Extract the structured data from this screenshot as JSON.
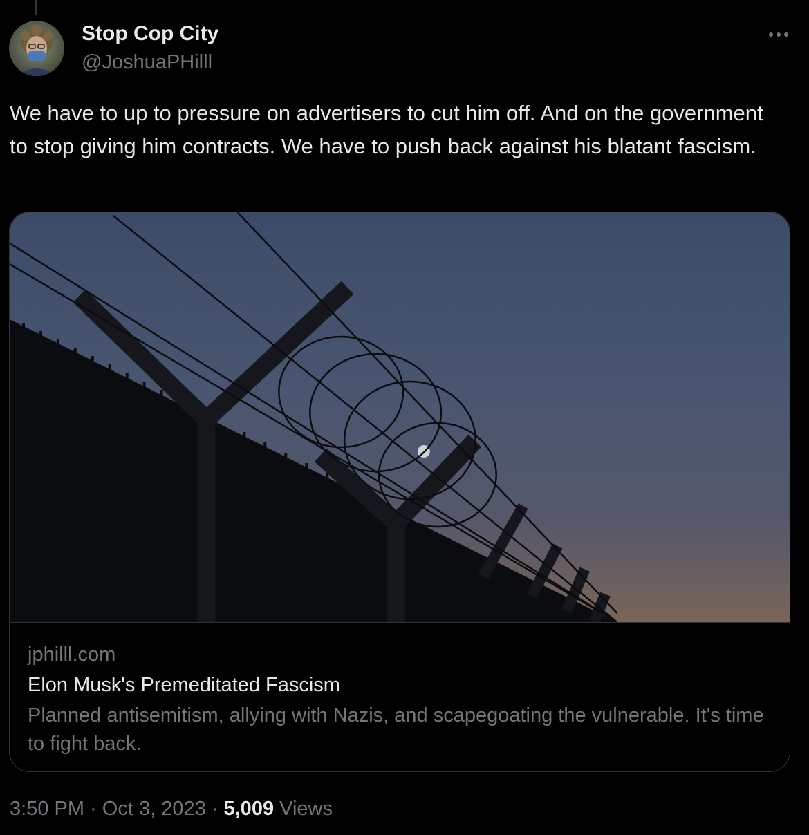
{
  "tweet": {
    "display_name": "Stop Cop City",
    "handle": "@JoshuaPHilll",
    "avatar_icon": "user-avatar",
    "more_icon": "more-options-icon",
    "text": "We have to up to pressure on advertisers to cut him off. And on the government to stop giving him contracts. We have to push back against his blatant fascism.",
    "card": {
      "image_subject": "barbed-wire-fence",
      "domain": "jphilll.com",
      "title": "Elon Musk's Premeditated Fascism",
      "description": "Planned antisemitism, allying with Nazis, and scapegoating the vulnerable. It's time to fight back."
    },
    "time": "3:50 PM",
    "separator": " · ",
    "date": "Oct 3, 2023",
    "views_count": "5,009",
    "views_label": "Views"
  },
  "colors": {
    "background": "#000000",
    "text_primary": "#e7e9ea",
    "text_secondary": "#71767b",
    "border": "#2f3336"
  }
}
